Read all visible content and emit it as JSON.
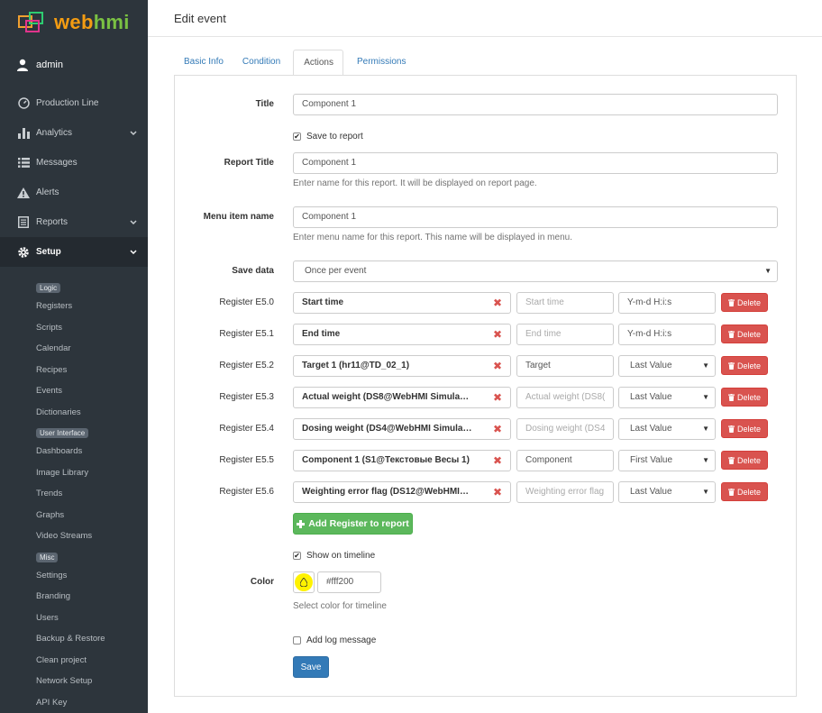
{
  "brand": {
    "part1": "web",
    "part2": "hmi"
  },
  "user": {
    "name": "admin"
  },
  "nav": [
    {
      "label": "Production Line",
      "icon": "dashboard-icon"
    },
    {
      "label": "Analytics",
      "icon": "bar-chart-icon"
    },
    {
      "label": "Messages",
      "icon": "list-icon"
    },
    {
      "label": "Alerts",
      "icon": "warning-icon"
    },
    {
      "label": "Reports",
      "icon": "report-icon"
    },
    {
      "label": "Setup",
      "icon": "gear-icon"
    }
  ],
  "submenu": {
    "logic_badge": "Logic",
    "logic": [
      "Registers",
      "Scripts",
      "Calendar",
      "Recipes",
      "Events",
      "Dictionaries"
    ],
    "ui_badge": "User Interface",
    "ui": [
      "Dashboards",
      "Image Library",
      "Trends",
      "Graphs",
      "Video Streams"
    ],
    "misc_badge": "Misc",
    "misc": [
      "Settings",
      "Branding",
      "Users",
      "Backup & Restore",
      "Clean project",
      "Network Setup",
      "API Key"
    ]
  },
  "page_title": "Edit event",
  "tabs": [
    "Basic Info",
    "Condition",
    "Actions",
    "Permissions"
  ],
  "form": {
    "title_label": "Title",
    "title_value": "Component 1",
    "save_to_report": "Save to report",
    "report_title_label": "Report Title",
    "report_title_value": "Component 1",
    "report_title_help": "Enter name for this report. It will be displayed on report page.",
    "menu_item_label": "Menu item name",
    "menu_item_value": "Component 1",
    "menu_item_help": "Enter menu name for this report. This name will be displayed in menu.",
    "save_data_label": "Save data",
    "save_data_value": "Once per event",
    "registers": [
      {
        "label": "Register E5.0",
        "register": "Start time",
        "name": "",
        "name_placeholder": "Start time",
        "type": "Y-m-d H:i:s",
        "type_is_select": false
      },
      {
        "label": "Register E5.1",
        "register": "End time",
        "name": "",
        "name_placeholder": "End time",
        "type": "Y-m-d H:i:s",
        "type_is_select": false
      },
      {
        "label": "Register E5.2",
        "register": "Target 1 (hr11@TD_02_1)",
        "name": "Target",
        "name_placeholder": "",
        "type": "Last Value",
        "type_is_select": true
      },
      {
        "label": "Register E5.3",
        "register": "Actual weight (DS8@WebHMI Simula…",
        "name": "",
        "name_placeholder": "Actual weight (DS8(",
        "type": "Last Value",
        "type_is_select": true
      },
      {
        "label": "Register E5.4",
        "register": "Dosing weight (DS4@WebHMI Simula…",
        "name": "",
        "name_placeholder": "Dosing weight (DS4",
        "type": "Last Value",
        "type_is_select": true
      },
      {
        "label": "Register E5.5",
        "register": "Component 1 (S1@Текстовые Весы 1)",
        "name": "Component",
        "name_placeholder": "",
        "type": "First Value",
        "type_is_select": true
      },
      {
        "label": "Register E5.6",
        "register": "Weighting error flag (DS12@WebHMI…",
        "name": "",
        "name_placeholder": "Weighting error flag",
        "type": "Last Value",
        "type_is_select": true
      }
    ],
    "delete_label": "Delete",
    "add_register_label": "Add Register to report",
    "show_on_timeline": "Show on timeline",
    "color_label": "Color",
    "color_value": "#fff200",
    "color_help": "Select color for timeline",
    "add_log_message": "Add log message",
    "save_label": "Save"
  },
  "colors": {
    "accent": "#337ab7",
    "danger": "#d9534f",
    "success": "#5cb85c",
    "sidebar": "#2d353c",
    "timeline": "#fff200"
  }
}
